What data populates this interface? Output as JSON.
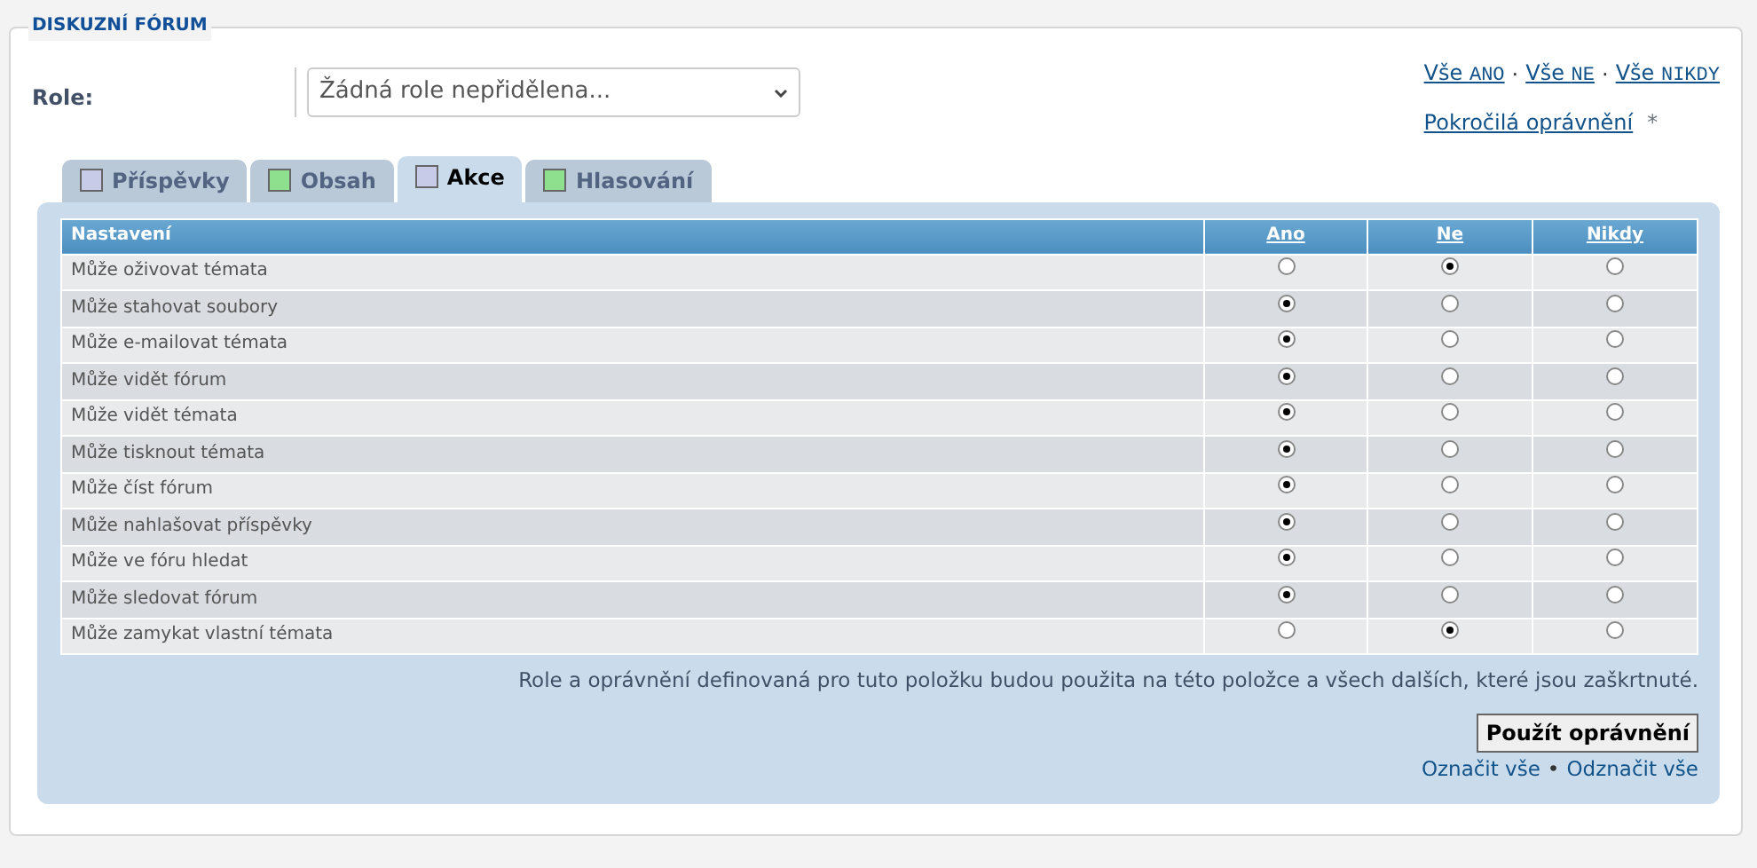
{
  "section_title": "DISKUZNÍ FÓRUM",
  "role": {
    "label": "Role:",
    "value": "Žádná role nepřidělena..."
  },
  "quick_links": [
    {
      "prefix": "Vše",
      "code": "ANO"
    },
    {
      "prefix": "Vše",
      "code": "NE"
    },
    {
      "prefix": "Vše",
      "code": "NIKDY"
    }
  ],
  "quick_link_separator": "·",
  "advanced_link": "Pokročilá oprávnění",
  "advanced_mark": "*",
  "tabs": [
    {
      "label": "Příspěvky",
      "color": "#c8cbe8",
      "selected": false
    },
    {
      "label": "Obsah",
      "color": "#8ee08e",
      "selected": false
    },
    {
      "label": "Akce",
      "color": "#c8cbe8",
      "selected": true
    },
    {
      "label": "Hlasování",
      "color": "#8ee08e",
      "selected": false
    }
  ],
  "table": {
    "columns": [
      "Nastavení",
      "Ano",
      "Ne",
      "Nikdy"
    ],
    "rows": [
      {
        "label": "Může oživovat témata",
        "options": [
          {
            "selected": false
          },
          {
            "selected": true
          },
          {
            "selected": false
          }
        ]
      },
      {
        "label": "Může stahovat soubory",
        "options": [
          {
            "selected": true
          },
          {
            "selected": false
          },
          {
            "selected": false
          }
        ]
      },
      {
        "label": "Může e-mailovat témata",
        "options": [
          {
            "selected": true
          },
          {
            "selected": false
          },
          {
            "selected": false
          }
        ]
      },
      {
        "label": "Může vidět fórum",
        "options": [
          {
            "selected": true
          },
          {
            "selected": false
          },
          {
            "selected": false
          }
        ]
      },
      {
        "label": "Může vidět témata",
        "options": [
          {
            "selected": true
          },
          {
            "selected": false
          },
          {
            "selected": false
          }
        ]
      },
      {
        "label": "Může tisknout témata",
        "options": [
          {
            "selected": true
          },
          {
            "selected": false
          },
          {
            "selected": false
          }
        ]
      },
      {
        "label": "Může číst fórum",
        "options": [
          {
            "selected": true
          },
          {
            "selected": false
          },
          {
            "selected": false
          }
        ]
      },
      {
        "label": "Může nahlašovat příspěvky",
        "options": [
          {
            "selected": true
          },
          {
            "selected": false
          },
          {
            "selected": false
          }
        ]
      },
      {
        "label": "Může ve fóru hledat",
        "options": [
          {
            "selected": true
          },
          {
            "selected": false
          },
          {
            "selected": false
          }
        ]
      },
      {
        "label": "Může sledovat fórum",
        "options": [
          {
            "selected": true
          },
          {
            "selected": false
          },
          {
            "selected": false
          }
        ]
      },
      {
        "label": "Může zamykat vlastní témata",
        "options": [
          {
            "selected": false
          },
          {
            "selected": true
          },
          {
            "selected": false
          }
        ]
      }
    ]
  },
  "note": "Role a oprávnění definovaná pro tuto položku budou použita na této položce a všech dalších, které jsou zaškrtnuté.",
  "apply_button": "Použít oprávnění",
  "select_links": [
    "Označit vše",
    "Odznačit vše"
  ],
  "select_separator": "•"
}
